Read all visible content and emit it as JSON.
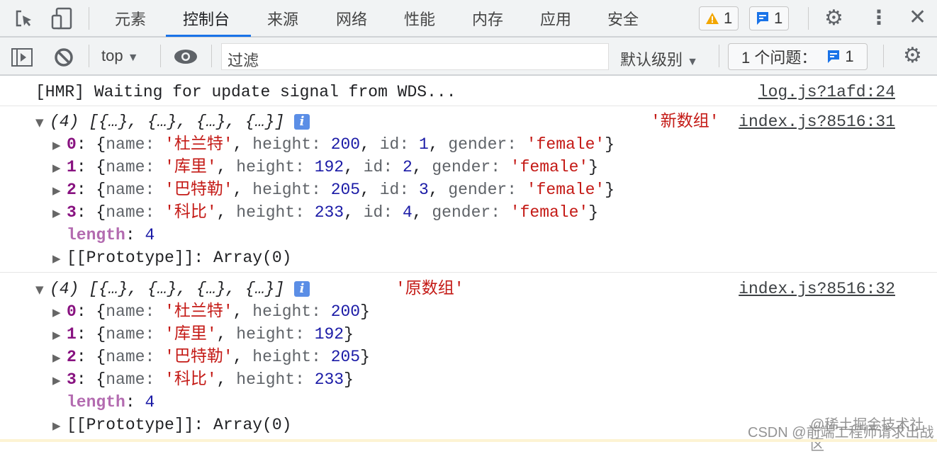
{
  "toolbar": {
    "tabs": [
      "元素",
      "控制台",
      "来源",
      "网络",
      "性能",
      "内存",
      "应用",
      "安全"
    ],
    "active_tab": 1,
    "warnings": "1",
    "messages": "1"
  },
  "console_toolbar": {
    "context": "top",
    "filter_placeholder": "过滤",
    "level": "默认级别",
    "issues_label": "1 个问题：",
    "issues_count": "1"
  },
  "colors": {
    "accent": "#1a73e8",
    "string": "#c41a16",
    "number": "#1a1aa6",
    "index": "#881280"
  },
  "console": {
    "hmr": {
      "text": "[HMR] Waiting for update signal from WDS...",
      "source": "log.js?1afd:24"
    },
    "groups": [
      {
        "summary": "(4) [{…}, {…}, {…}, {…}]",
        "label": "'新数组'",
        "source": "index.js?8516:31",
        "items": [
          [
            [
              "name",
              "杜兰特",
              "s"
            ],
            [
              "height",
              "200",
              "n"
            ],
            [
              "id",
              "1",
              "n"
            ],
            [
              "gender",
              "female",
              "s"
            ]
          ],
          [
            [
              "name",
              "库里",
              "s"
            ],
            [
              "height",
              "192",
              "n"
            ],
            [
              "id",
              "2",
              "n"
            ],
            [
              "gender",
              "female",
              "s"
            ]
          ],
          [
            [
              "name",
              "巴特勒",
              "s"
            ],
            [
              "height",
              "205",
              "n"
            ],
            [
              "id",
              "3",
              "n"
            ],
            [
              "gender",
              "female",
              "s"
            ]
          ],
          [
            [
              "name",
              "科比",
              "s"
            ],
            [
              "height",
              "233",
              "n"
            ],
            [
              "id",
              "4",
              "n"
            ],
            [
              "gender",
              "female",
              "s"
            ]
          ]
        ],
        "length": "4",
        "prototype": "[[Prototype]]: Array(0)"
      },
      {
        "summary": "(4) [{…}, {…}, {…}, {…}]",
        "label": "'原数组'",
        "source": "index.js?8516:32",
        "items": [
          [
            [
              "name",
              "杜兰特",
              "s"
            ],
            [
              "height",
              "200",
              "n"
            ]
          ],
          [
            [
              "name",
              "库里",
              "s"
            ],
            [
              "height",
              "192",
              "n"
            ]
          ],
          [
            [
              "name",
              "巴特勒",
              "s"
            ],
            [
              "height",
              "205",
              "n"
            ]
          ],
          [
            [
              "name",
              "科比",
              "s"
            ],
            [
              "height",
              "233",
              "n"
            ]
          ]
        ],
        "length": "4",
        "prototype": "[[Prototype]]: Array(0)"
      }
    ]
  },
  "watermark": {
    "line1": "@稀土掘金技术社区",
    "line2": "CSDN @前端工程师请求出战"
  }
}
